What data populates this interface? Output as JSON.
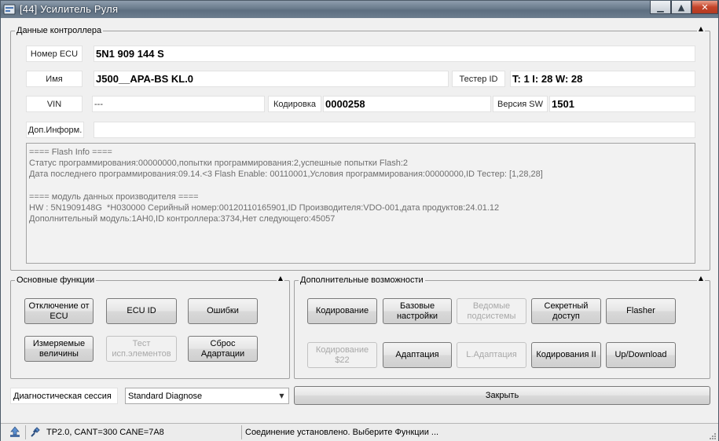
{
  "window": {
    "title": "[44] Усилитель Руля"
  },
  "controller_group": {
    "title": "Данные контроллера",
    "ecu_number_label": "Номер ECU",
    "ecu_number_value": "5N1 909 144 S",
    "name_label": "Имя",
    "name_value": "J500__APA-BS KL.0",
    "tester_id_label": "Тестер ID",
    "tester_id_value": "T: 1 I: 28 W: 28",
    "vin_label": "VIN",
    "vin_value": "---",
    "coding_label": "Кодировка",
    "coding_value": "0000258",
    "sw_version_label": "Версия SW",
    "sw_version_value": "1501",
    "extra_info_label": "Доп.Информ.",
    "extra_info_value": "",
    "info_text": "==== Flash Info ====\nСтатус программирования:00000000,попытки программирования:2,успешные попытки Flash:2\nДата последнего программирования:09.14.<3 Flash Enable: 00110001,Условия программирования:00000000,ID Тестер: [1,28,28]\n\n==== модуль данных производителя ====\nHW : 5N1909148G  *H030000 Серийный номер:00120110165901,ID Производителя:VDO-001,дата продуктов:24.01.12\nДополнительный модуль:1AH0,ID контроллера:3734,Нет следующего:45057"
  },
  "basic_functions": {
    "title": "Основные функции",
    "buttons": {
      "disconnect": "Отключение от ECU",
      "ecu_id": "ECU ID",
      "errors": "Ошибки",
      "measured_values": "Измеряемые величины",
      "output_test": "Тест исп.элементов",
      "reset_adaptation": "Сброс Адартации"
    }
  },
  "extra_functions": {
    "title": "Дополнительные возможности",
    "buttons": {
      "coding": "Кодирование",
      "basic_settings": "Базовые настройки",
      "subsystems": "Ведомые подсистемы",
      "security_access": "Секретный доступ",
      "flasher": "Flasher",
      "coding_22": "Кодирование $22",
      "adaptation": "Адаптация",
      "l_adaptation": "L.Адаптация",
      "coding_2": "Кодирования II",
      "up_download": "Up/Download"
    }
  },
  "session": {
    "label": "Диагностическая сессия",
    "selected": "Standard Diagnose"
  },
  "close_label": "Закрыть",
  "status": {
    "protocol": "TP2.0, CANT=300 CANE=7A8",
    "message": "Соединение установлено. Выберите Функции ..."
  }
}
